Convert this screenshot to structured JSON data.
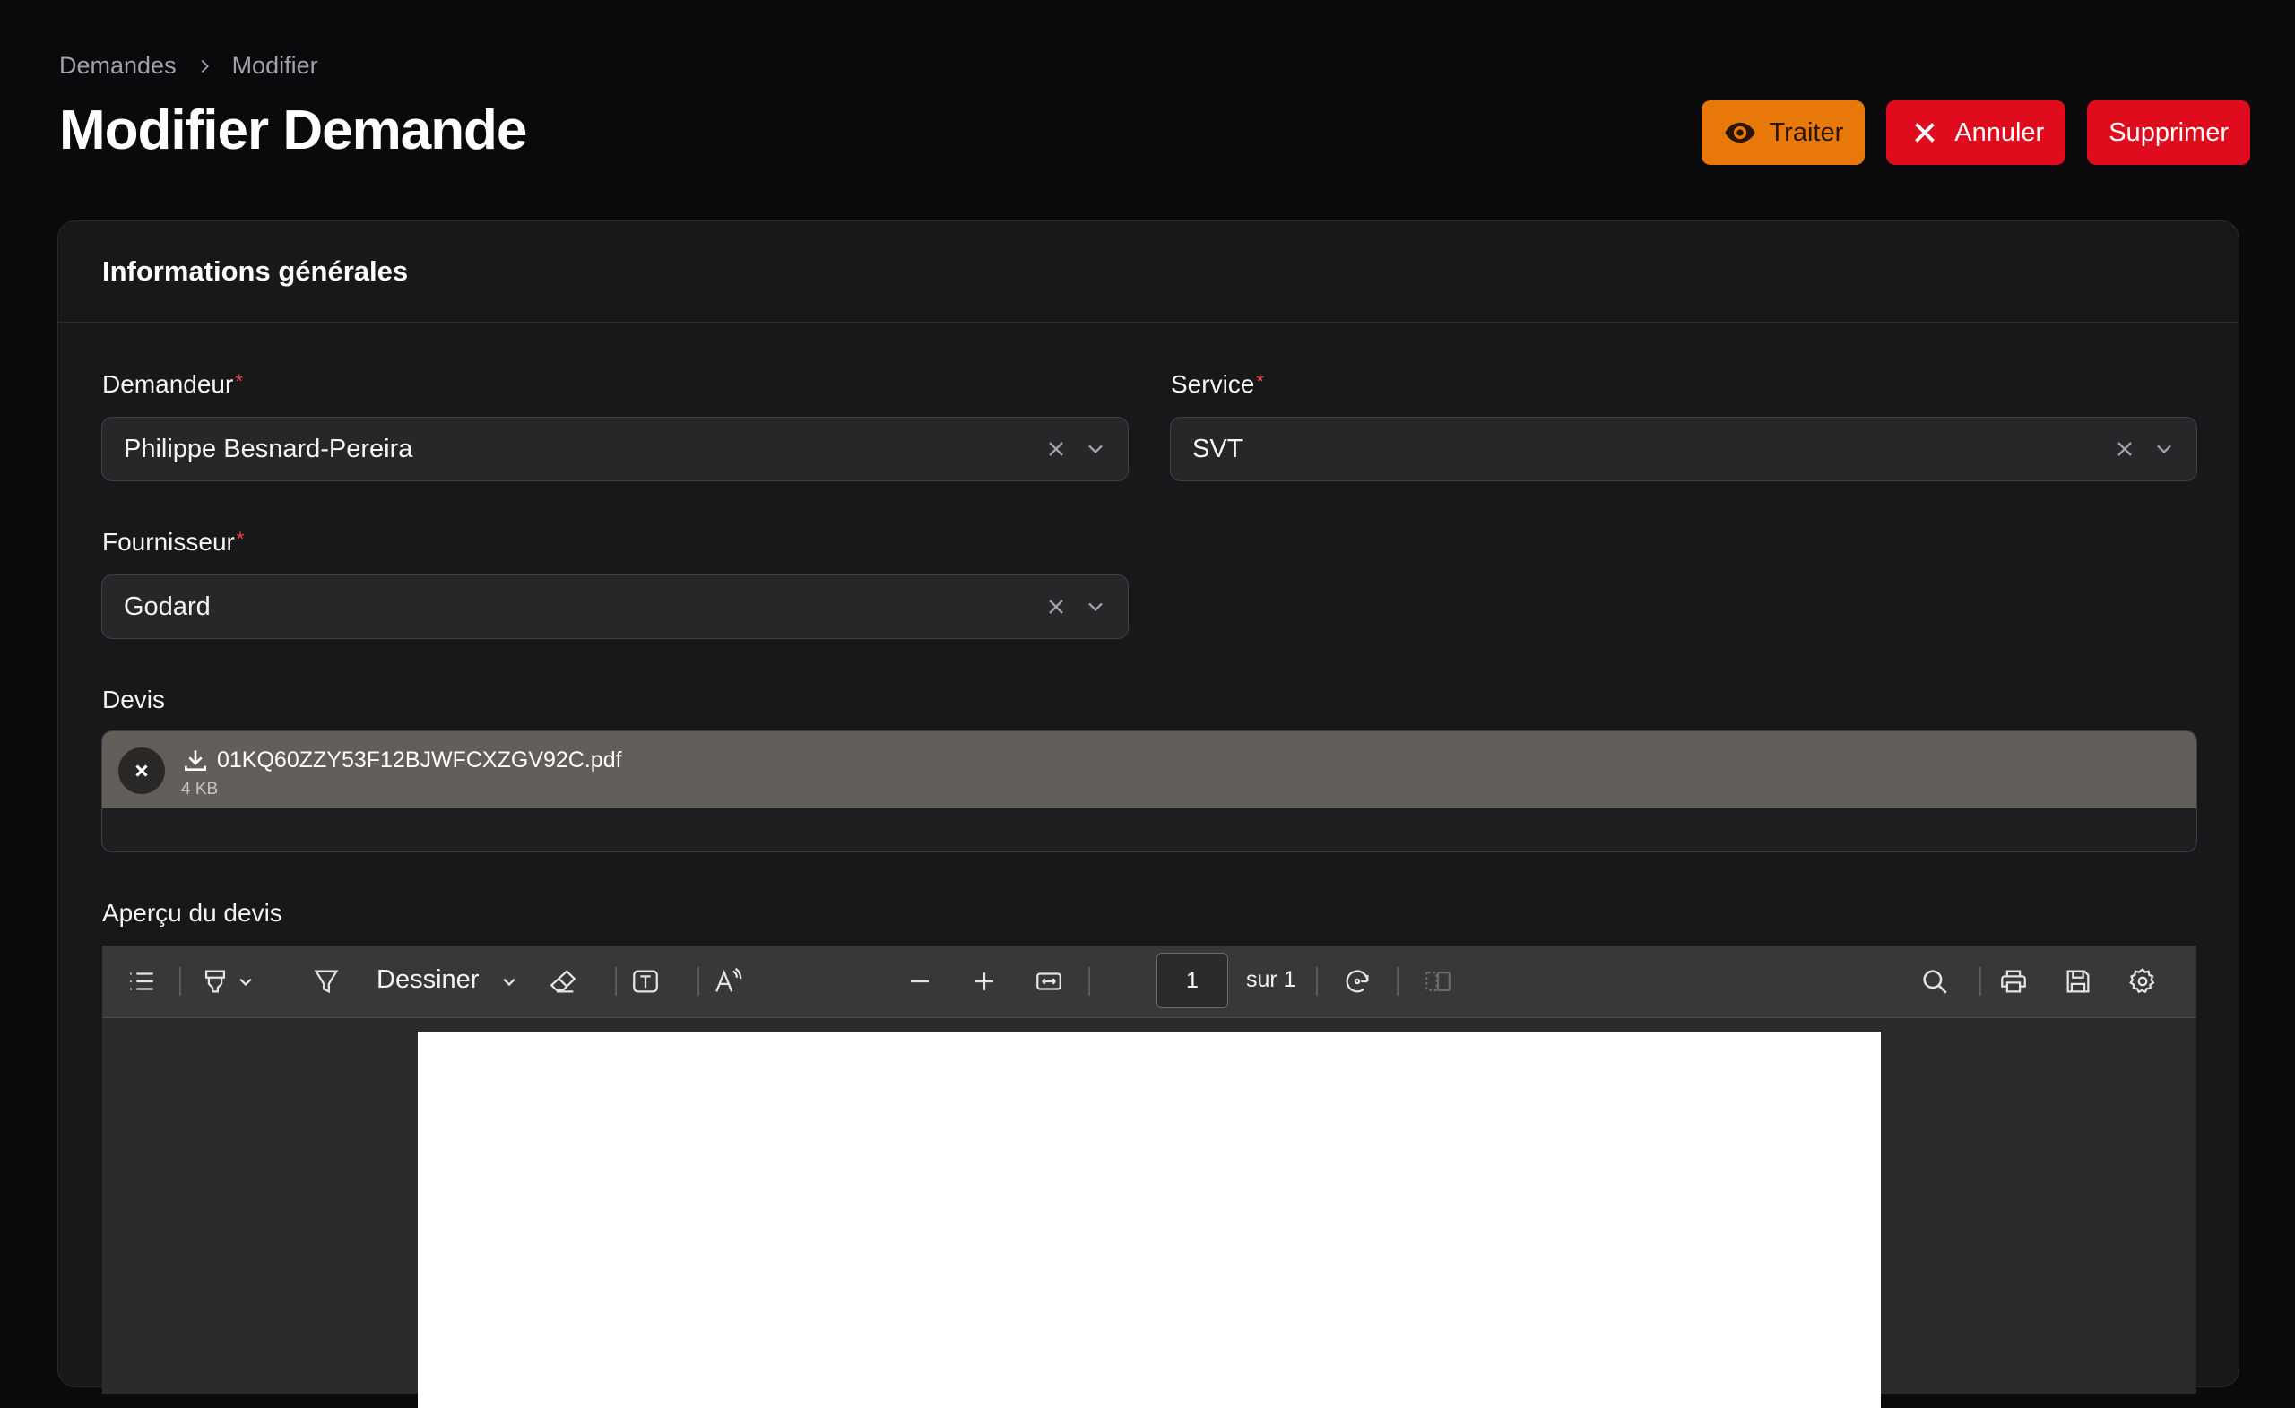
{
  "breadcrumb": {
    "parent": "Demandes",
    "current": "Modifier"
  },
  "page": {
    "title": "Modifier Demande"
  },
  "actions": {
    "process": "Traiter",
    "cancel": "Annuler",
    "delete": "Supprimer"
  },
  "colors": {
    "process_button": "#e8780a",
    "danger_button": "#e00b1c",
    "required_marker": "#ef4444"
  },
  "section": {
    "title": "Informations générales"
  },
  "fields": {
    "requester": {
      "label": "Demandeur",
      "required": "*",
      "value": "Philippe Besnard-Pereira"
    },
    "service": {
      "label": "Service",
      "required": "*",
      "value": "SVT"
    },
    "supplier": {
      "label": "Fournisseur",
      "required": "*",
      "value": "Godard"
    }
  },
  "quote": {
    "label": "Devis",
    "file_name": "01KQ60ZZY53F12BJWFCXZGV92C.pdf",
    "file_size": "4 KB"
  },
  "preview": {
    "label": "Aperçu du devis",
    "draw_label": "Dessiner",
    "page_number": "1",
    "page_total": "sur 1"
  }
}
